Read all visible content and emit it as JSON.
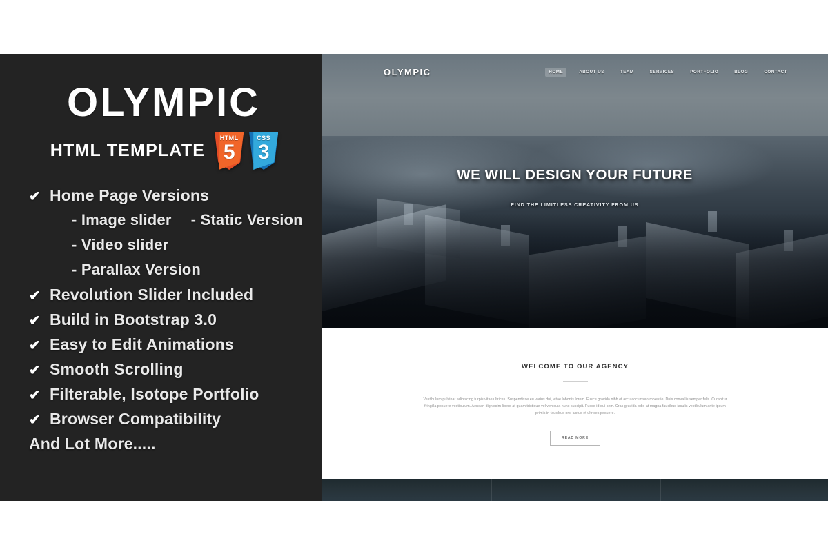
{
  "left_panel": {
    "title": "OLYMPIC",
    "subtitle": "HTML TEMPLATE",
    "badges": [
      {
        "name": "html5-badge",
        "tag": "HTML",
        "num": "5",
        "color": "#e44d26"
      },
      {
        "name": "css3-badge",
        "tag": "CSS",
        "num": "3",
        "color": "#1572b6"
      }
    ],
    "check_glyph": "✔",
    "features": [
      {
        "type": "check",
        "label": "Home Page Versions"
      },
      {
        "type": "sub-pair",
        "label": "- Image slider",
        "label2": "- Static Version"
      },
      {
        "type": "sub",
        "label": "- Video slider"
      },
      {
        "type": "sub",
        "label": "- Parallax Version"
      },
      {
        "type": "check",
        "label": "Revolution Slider Included"
      },
      {
        "type": "check",
        "label": "Build in Bootstrap 3.0"
      },
      {
        "type": "check",
        "label": "Easy to Edit Animations"
      },
      {
        "type": "check",
        "label": "Smooth Scrolling"
      },
      {
        "type": "check",
        "label": "Filterable, Isotope Portfolio"
      },
      {
        "type": "check",
        "label": "Browser Compatibility"
      },
      {
        "type": "plain",
        "label": "And Lot More....."
      }
    ]
  },
  "preview": {
    "nav": {
      "logo": "OLYMPIC",
      "items": [
        {
          "label": "HOME",
          "active": true
        },
        {
          "label": "ABOUT US",
          "active": false
        },
        {
          "label": "TEAM",
          "active": false
        },
        {
          "label": "SERVICES",
          "active": false
        },
        {
          "label": "PORTFOLIO",
          "active": false
        },
        {
          "label": "BLOG",
          "active": false
        },
        {
          "label": "CONTACT",
          "active": false
        }
      ]
    },
    "hero": {
      "headline": "WE WILL DESIGN YOUR FUTURE",
      "subheadline": "FIND THE LIMITLESS CREATIVITY FROM US",
      "image_alt": "snowy-city-rooftops"
    },
    "welcome": {
      "title": "WELCOME TO OUR AGENCY",
      "body": "Vestibulum pulvinar adipiscing turpis vitae ultrices. Suspendisse eu varius dui, vitae lobortis lorem. Fusce gravida nibh et arcu accumsan molestie. Duis convallis semper felis. Curabitur fringilla posuere vestibulum. Aenean dignissim libero at quam tristique vel vehicula nunc suscipit. Fusce id dui sem. Cras gravida odio at magna faucibus iaculis vestibulum ante ipsum primis in faucibus orci luctus et ultrices posuere.",
      "button": "READ MORE"
    }
  },
  "colors": {
    "panel_bg": "#232323",
    "page_bg": "#ffffff",
    "text_light": "#e9e9e9",
    "html5": "#e44d26",
    "css3": "#1572b6"
  }
}
